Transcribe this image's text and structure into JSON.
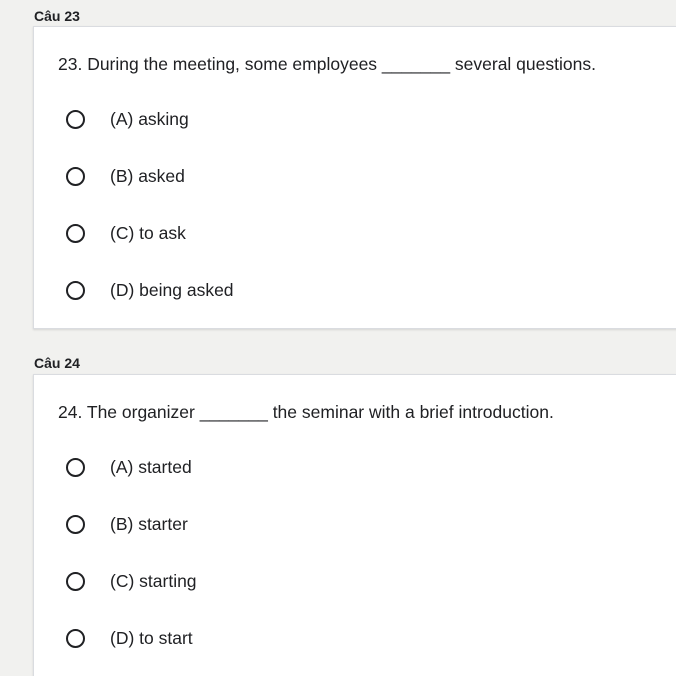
{
  "questions": [
    {
      "section_label": "Câu 23",
      "text": "23. During the meeting, some employees _______ several questions.",
      "options": [
        "(A) asking",
        "(B) asked",
        "(C) to ask",
        "(D) being asked"
      ]
    },
    {
      "section_label": "Câu 24",
      "text": "24. The organizer _______ the seminar with a brief introduction.",
      "options": [
        "(A) started",
        "(B) starter",
        "(C) starting",
        "(D) to start"
      ]
    }
  ],
  "icons": {
    "radio": "radio-unchecked-icon"
  },
  "colors": {
    "background": "#f1f1ef",
    "card": "#ffffff",
    "text": "#202124"
  }
}
